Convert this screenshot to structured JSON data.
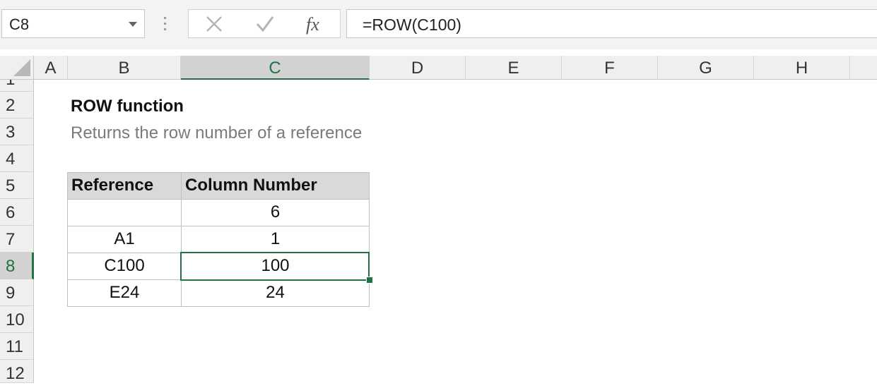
{
  "name_box": {
    "value": "C8"
  },
  "formula_bar": {
    "formula": "=ROW(C100)"
  },
  "columns": [
    "A",
    "B",
    "C",
    "D",
    "E",
    "F",
    "G",
    "H"
  ],
  "selected_column": "C",
  "rows": [
    "1",
    "2",
    "3",
    "4",
    "5",
    "6",
    "7",
    "8",
    "9",
    "10",
    "11",
    "12"
  ],
  "selected_row": "8",
  "sheet": {
    "title": "ROW function",
    "subtitle": "Returns the row number of a reference",
    "table": {
      "headers": [
        "Reference",
        "Column Number"
      ],
      "rows": [
        {
          "reference": "",
          "value": "6"
        },
        {
          "reference": "A1",
          "value": "1"
        },
        {
          "reference": "C100",
          "value": "100"
        },
        {
          "reference": "E24",
          "value": "24"
        }
      ]
    }
  },
  "colors": {
    "accent": "#217346",
    "header_fill": "#d9d9d9"
  },
  "icons": [
    "cancel-icon",
    "enter-icon",
    "fx-icon"
  ]
}
